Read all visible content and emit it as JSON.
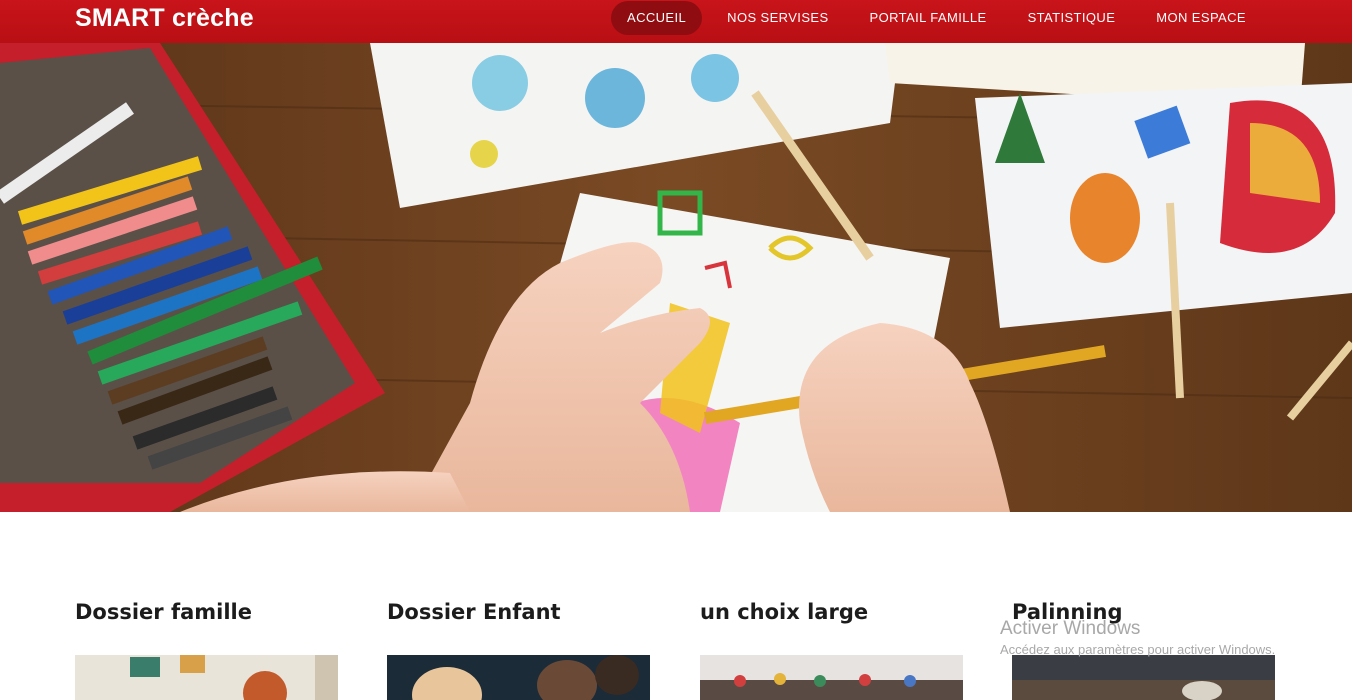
{
  "brand": "SMART crèche",
  "nav": {
    "items": [
      {
        "label": "ACCUEIL",
        "active": true
      },
      {
        "label": "NOS SERVISES",
        "active": false
      },
      {
        "label": "PORTAIL FAMILLE",
        "active": false
      },
      {
        "label": "STATISTIQUE",
        "active": false
      },
      {
        "label": "MON ESPACE",
        "active": false
      }
    ]
  },
  "colors": {
    "navbar": "#c8141a",
    "nav_active": "#8f0c10",
    "text_dark": "#1c1c1c"
  },
  "features": [
    {
      "title": "Dossier famille"
    },
    {
      "title": "Dossier Enfant"
    },
    {
      "title": "un choix large"
    },
    {
      "title": "Palinning"
    }
  ],
  "watermark": {
    "title": "Activer Windows",
    "subtitle": "Accédez aux paramètres pour activer Windows."
  }
}
